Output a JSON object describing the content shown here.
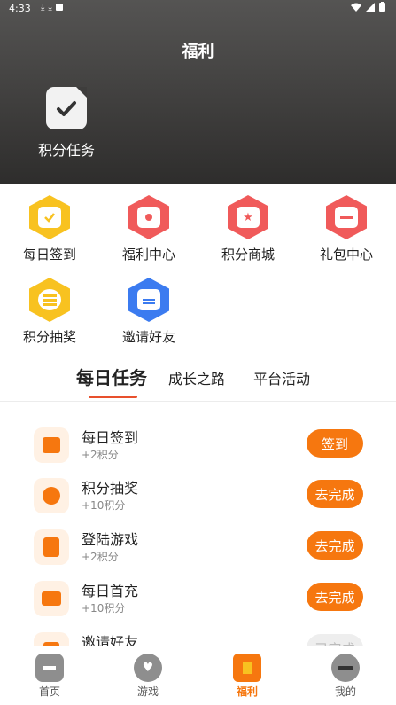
{
  "status_bar": {
    "time": "4:33",
    "icons": [
      "download-icon",
      "download-icon",
      "a-icon"
    ]
  },
  "header": {
    "title": "福利",
    "points_task_label": "积分任务"
  },
  "grid": [
    {
      "label": "每日签到",
      "icon": "calendar-icon",
      "color": "#f8c220"
    },
    {
      "label": "福利中心",
      "icon": "gift-icon",
      "color": "#f05a5a"
    },
    {
      "label": "积分商城",
      "icon": "star-box-icon",
      "color": "#f05a5a"
    },
    {
      "label": "礼包中心",
      "icon": "gift-box-icon",
      "color": "#f05a5a"
    },
    {
      "label": "积分抽奖",
      "icon": "coins-icon",
      "color": "#f8c220"
    },
    {
      "label": "邀请好友",
      "icon": "envelope-icon",
      "color": "#3b7bf0"
    }
  ],
  "tabs": [
    {
      "label": "每日任务",
      "active": true
    },
    {
      "label": "成长之路",
      "active": false
    },
    {
      "label": "平台活动",
      "active": false
    }
  ],
  "tasks": [
    {
      "name": "每日签到",
      "points": "+2积分",
      "button": "签到",
      "icon": "calendar-check-icon"
    },
    {
      "name": "积分抽奖",
      "points": "+10积分",
      "button": "去完成",
      "icon": "wheel-icon"
    },
    {
      "name": "登陆游戏",
      "points": "+2积分",
      "button": "去完成",
      "icon": "document-check-icon"
    },
    {
      "name": "每日首充",
      "points": "+10积分",
      "button": "去完成",
      "icon": "card-yen-icon"
    },
    {
      "name": "邀请好友",
      "points": "",
      "button": "已完成",
      "icon": "invite-icon"
    }
  ],
  "bottom_nav": [
    {
      "label": "首页",
      "icon": "gamepad-icon",
      "active": false
    },
    {
      "label": "游戏",
      "icon": "heart-search-icon",
      "active": false
    },
    {
      "label": "福利",
      "icon": "gift-icon",
      "active": true
    },
    {
      "label": "我的",
      "icon": "sunglasses-face-icon",
      "active": false
    }
  ],
  "colors": {
    "accent": "#f6770f",
    "tab_underline": "#e8502d",
    "header_dark": "#3e3d3c"
  }
}
